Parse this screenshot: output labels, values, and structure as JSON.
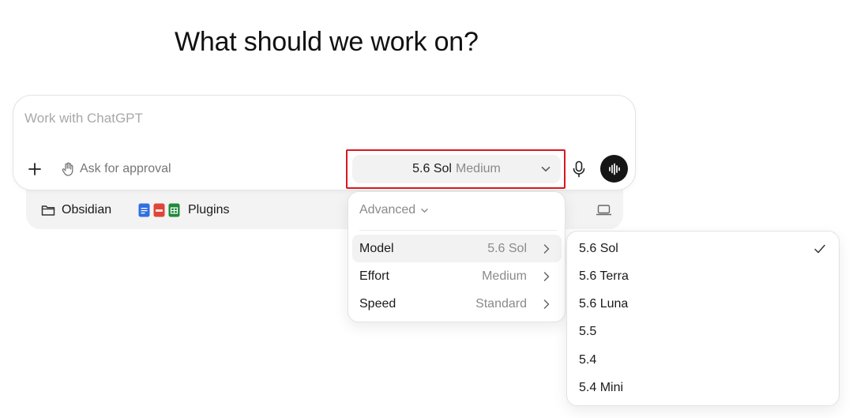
{
  "heading": "What should we work on?",
  "composer": {
    "placeholder": "Work with ChatGPT",
    "approval_label": "Ask for approval",
    "model_name": "5.6 Sol",
    "model_effort": "Medium"
  },
  "tray": {
    "folder_label": "Obsidian",
    "plugins_label": "Plugins"
  },
  "menu": {
    "advanced_label": "Advanced",
    "rows": [
      {
        "label": "Model",
        "value": "5.6 Sol"
      },
      {
        "label": "Effort",
        "value": "Medium"
      },
      {
        "label": "Speed",
        "value": "Standard"
      }
    ]
  },
  "model_list": {
    "items": [
      "5.6 Sol",
      "5.6 Terra",
      "5.6 Luna",
      "5.5",
      "5.4",
      "5.4 Mini"
    ],
    "selected": "5.6 Sol"
  },
  "colors": {
    "highlight": "#d71920",
    "voice_button": "#161616",
    "docs_icon": "#2f6fe0",
    "pdf_icon": "#e0453a",
    "sheets_icon": "#1f8a3c"
  }
}
